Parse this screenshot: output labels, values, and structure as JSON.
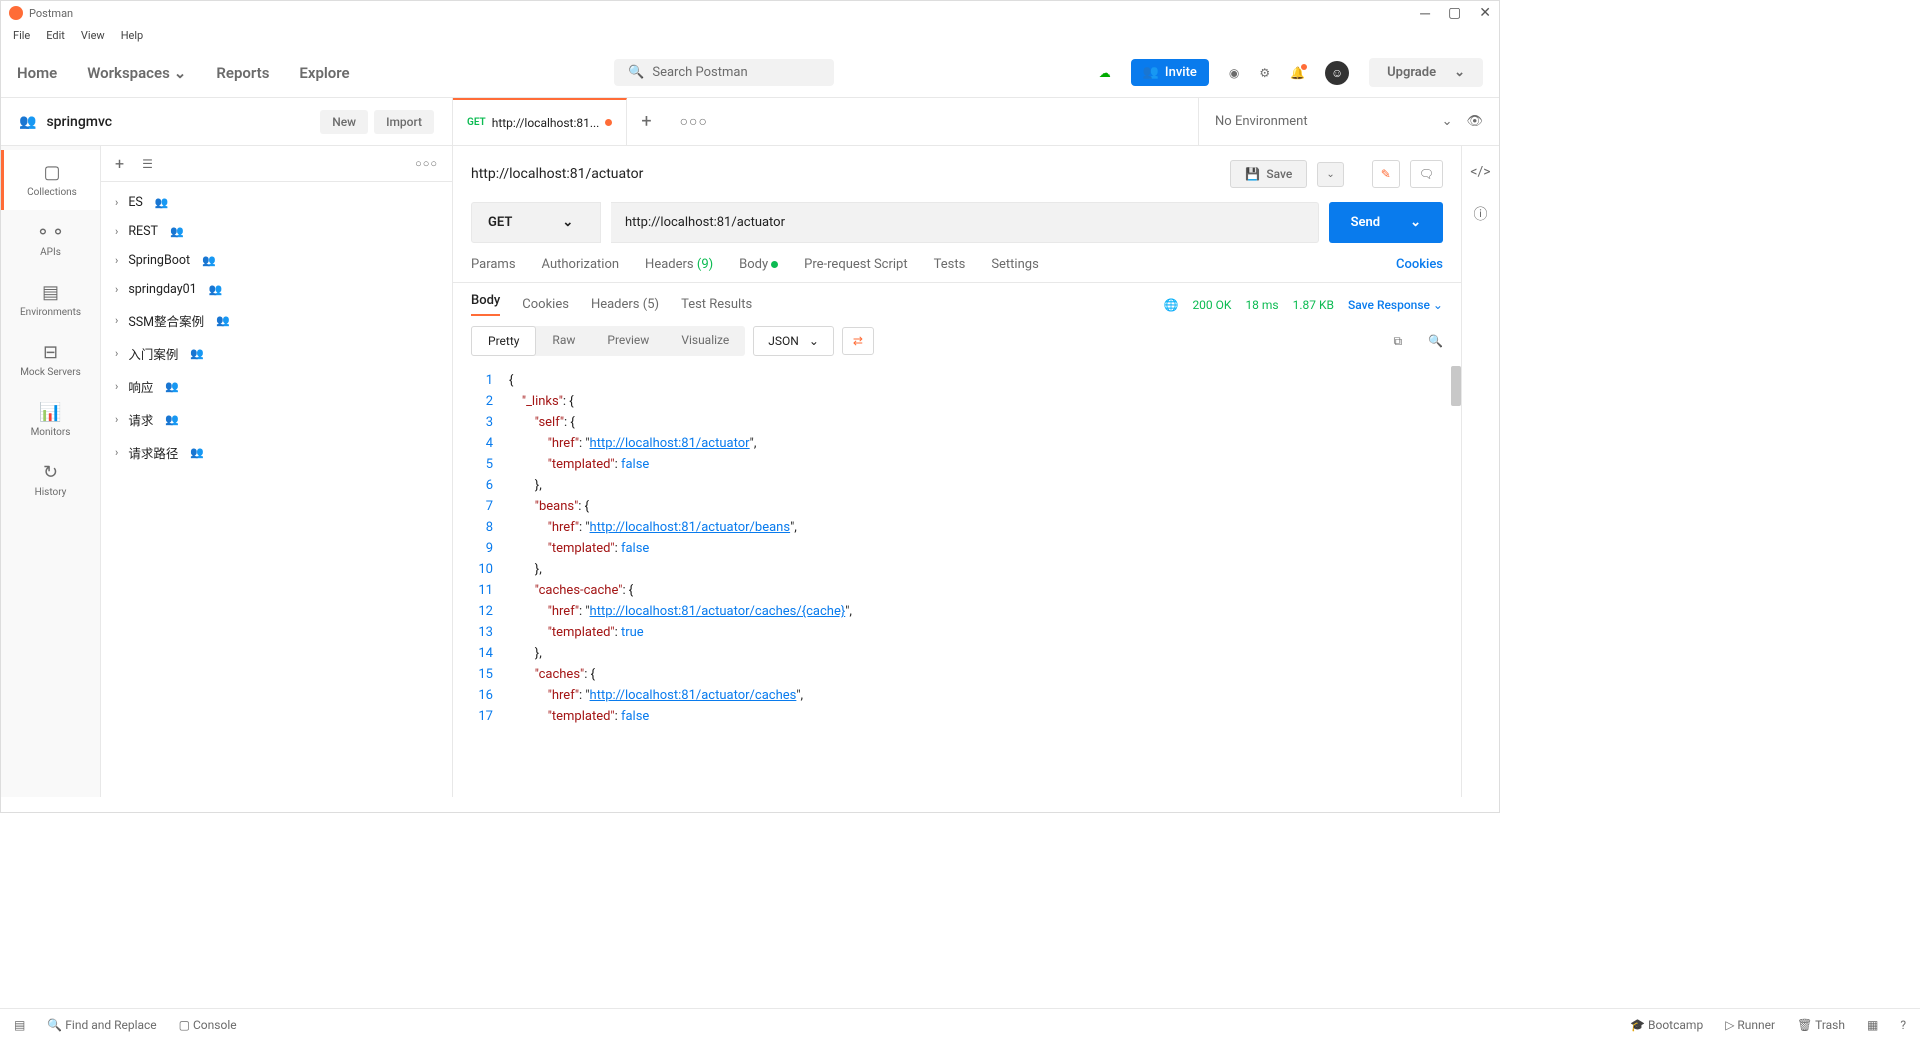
{
  "app": {
    "title": "Postman"
  },
  "menu": [
    "File",
    "Edit",
    "View",
    "Help"
  ],
  "nav": {
    "home": "Home",
    "workspaces": "Workspaces",
    "reports": "Reports",
    "explore": "Explore"
  },
  "search": {
    "placeholder": "Search Postman"
  },
  "invite": "Invite",
  "upgrade": "Upgrade",
  "workspace": {
    "name": "springmvc",
    "new": "New",
    "import": "Import"
  },
  "tab": {
    "method": "GET",
    "label": "http://localhost:81..."
  },
  "env": {
    "label": "No Environment"
  },
  "rail": {
    "collections": "Collections",
    "apis": "APIs",
    "environments": "Environments",
    "mock": "Mock Servers",
    "monitors": "Monitors",
    "history": "History"
  },
  "collections": [
    "ES",
    "REST",
    "SpringBoot",
    "springday01",
    "SSM整合案例",
    "入门案例",
    "响应",
    "请求",
    "请求路径"
  ],
  "request": {
    "title": "http://localhost:81/actuator",
    "method": "GET",
    "url": "http://localhost:81/actuator",
    "save": "Save",
    "send": "Send"
  },
  "reqTabs": {
    "params": "Params",
    "auth": "Authorization",
    "headers": "Headers",
    "headersCount": "(9)",
    "body": "Body",
    "prereq": "Pre-request Script",
    "tests": "Tests",
    "settings": "Settings",
    "cookies": "Cookies"
  },
  "respTabs": {
    "body": "Body",
    "cookies": "Cookies",
    "headers": "Headers",
    "headersCount": "(5)",
    "tests": "Test Results"
  },
  "status": {
    "code": "200 OK",
    "time": "18 ms",
    "size": "1.87 KB",
    "save": "Save Response"
  },
  "fmt": {
    "pretty": "Pretty",
    "raw": "Raw",
    "preview": "Preview",
    "visualize": "Visualize",
    "json": "JSON"
  },
  "response": {
    "lines": [
      {
        "n": 1,
        "indent": 0,
        "html": "<span class='tok-punc'>{</span>"
      },
      {
        "n": 2,
        "indent": 1,
        "html": "<span class='tok-key'>\"_links\"</span><span class='tok-punc'>: {</span>"
      },
      {
        "n": 3,
        "indent": 2,
        "html": "<span class='tok-key'>\"self\"</span><span class='tok-punc'>: {</span>"
      },
      {
        "n": 4,
        "indent": 3,
        "html": "<span class='tok-key'>\"href\"</span><span class='tok-punc'>: \"</span><span class='tok-url'>http://localhost:81/actuator</span><span class='tok-punc'>\",</span>"
      },
      {
        "n": 5,
        "indent": 3,
        "html": "<span class='tok-key'>\"templated\"</span><span class='tok-punc'>: </span><span class='tok-bool'>false</span>"
      },
      {
        "n": 6,
        "indent": 2,
        "html": "<span class='tok-punc'>},</span>"
      },
      {
        "n": 7,
        "indent": 2,
        "html": "<span class='tok-key'>\"beans\"</span><span class='tok-punc'>: {</span>"
      },
      {
        "n": 8,
        "indent": 3,
        "html": "<span class='tok-key'>\"href\"</span><span class='tok-punc'>: \"</span><span class='tok-url'>http://localhost:81/actuator/beans</span><span class='tok-punc'>\",</span>"
      },
      {
        "n": 9,
        "indent": 3,
        "html": "<span class='tok-key'>\"templated\"</span><span class='tok-punc'>: </span><span class='tok-bool'>false</span>"
      },
      {
        "n": 10,
        "indent": 2,
        "html": "<span class='tok-punc'>},</span>"
      },
      {
        "n": 11,
        "indent": 2,
        "html": "<span class='tok-key'>\"caches-cache\"</span><span class='tok-punc'>: {</span>"
      },
      {
        "n": 12,
        "indent": 3,
        "html": "<span class='tok-key'>\"href\"</span><span class='tok-punc'>: \"</span><span class='tok-url'>http://localhost:81/actuator/caches/{cache}</span><span class='tok-punc'>\",</span>"
      },
      {
        "n": 13,
        "indent": 3,
        "html": "<span class='tok-key'>\"templated\"</span><span class='tok-punc'>: </span><span class='tok-bool'>true</span>"
      },
      {
        "n": 14,
        "indent": 2,
        "html": "<span class='tok-punc'>},</span>"
      },
      {
        "n": 15,
        "indent": 2,
        "html": "<span class='tok-key'>\"caches\"</span><span class='tok-punc'>: {</span>"
      },
      {
        "n": 16,
        "indent": 3,
        "html": "<span class='tok-key'>\"href\"</span><span class='tok-punc'>: \"</span><span class='tok-url'>http://localhost:81/actuator/caches</span><span class='tok-punc'>\",</span>"
      },
      {
        "n": 17,
        "indent": 3,
        "html": "<span class='tok-key'>\"templated\"</span><span class='tok-punc'>: </span><span class='tok-bool'>false</span>"
      }
    ]
  },
  "footer": {
    "find": "Find and Replace",
    "console": "Console",
    "bootcamp": "Bootcamp",
    "runner": "Runner",
    "trash": "Trash"
  }
}
